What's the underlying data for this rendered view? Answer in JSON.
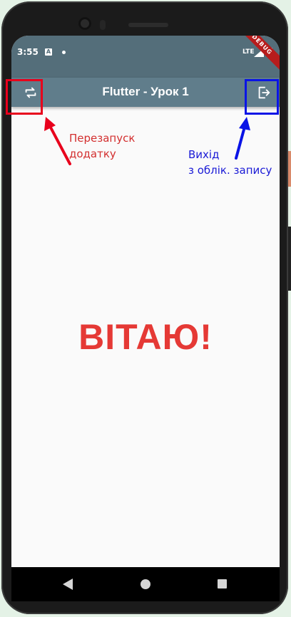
{
  "statusbar": {
    "time": "3:55",
    "notif_letter": "A",
    "network": "LTE",
    "debug_banner": "DEBUG"
  },
  "appbar": {
    "title": "Flutter - Урок 1",
    "left_icon": "repeat-icon",
    "right_icon": "exit-icon"
  },
  "main": {
    "greeting": "ВІТАЮ!"
  },
  "annotations": {
    "restart_line1": "Перезапуск",
    "restart_line2": "додатку",
    "logout_line1": "Вихід",
    "logout_line2": "з облік. запису",
    "restart_color": "#e8001c",
    "logout_color": "#0a14e6"
  },
  "colors": {
    "statusbar": "#546e7a",
    "appbar": "#607d8b",
    "greeting": "#e53935",
    "background": "#fafafa"
  },
  "navbar": {
    "back_icon": "back-triangle-icon",
    "home_icon": "home-circle-icon",
    "recents_icon": "recents-square-icon"
  }
}
